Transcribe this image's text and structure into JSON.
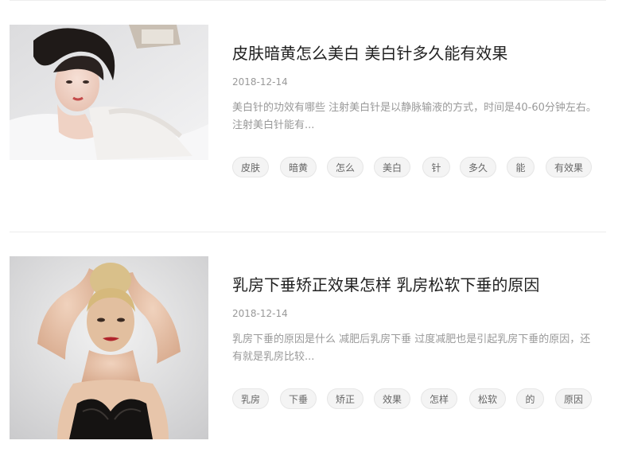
{
  "articles": [
    {
      "title": "皮肤暗黄怎么美白 美白针多久能有效果",
      "date": "2018-12-14",
      "summary": "美白针的功效有哪些 注射美白针是以静脉输液的方式，时间是40-60分钟左右。注射美白针能有...",
      "tags": [
        "皮肤",
        "暗黄",
        "怎么",
        "美白",
        "针",
        "多久",
        "能",
        "有效果"
      ]
    },
    {
      "title": "乳房下垂矫正效果怎样 乳房松软下垂的原因",
      "date": "2018-12-14",
      "summary": "乳房下垂的原因是什么 减肥后乳房下垂 过度减肥也是引起乳房下垂的原因，还有就是乳房比较...",
      "tags": [
        "乳房",
        "下垂",
        "矫正",
        "效果",
        "怎样",
        "松软",
        "的",
        "原因"
      ]
    }
  ],
  "colors": {
    "title": "#222222",
    "meta": "#999999",
    "tag_bg": "#f4f4f4",
    "tag_text": "#666666",
    "divider": "#ececec"
  }
}
